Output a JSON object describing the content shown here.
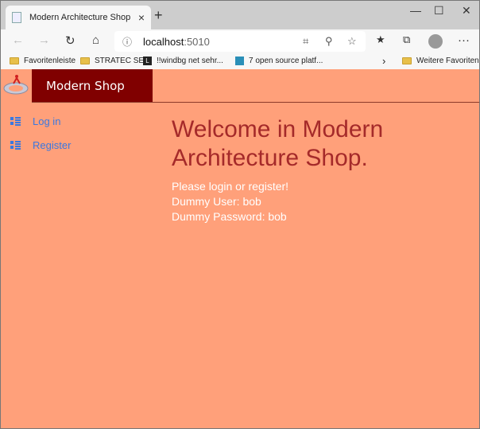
{
  "browser": {
    "tab_title": "Modern Architecture Shop",
    "close_tab": "×",
    "new_tab": "+",
    "window_controls": {
      "minimize": "—",
      "maximize": "☐",
      "close": "✕"
    },
    "url_host": "localhost",
    "url_port": ":5010",
    "bookmarks": [
      "Favoritenleiste",
      "STRATEC SE",
      "!!windbg  net sehr...",
      "7 open source platf..."
    ],
    "bookmarks_more": "›",
    "other_favorites": "Weitere Favoriten"
  },
  "header": {
    "brand": "Modern Shop"
  },
  "sidebar": {
    "items": [
      {
        "label": "Log in",
        "icon": "list-icon"
      },
      {
        "label": "Register",
        "icon": "list-icon"
      }
    ]
  },
  "main": {
    "title": "Welcome in Modern Architecture Shop.",
    "lines": [
      "Please login or register!",
      "Dummy User: bob",
      "Dummy Password: bob"
    ]
  },
  "colors": {
    "page_bg": "#ffa07a",
    "brand_bg": "#800000",
    "title": "#a52a2a",
    "link": "#3a78e0"
  }
}
